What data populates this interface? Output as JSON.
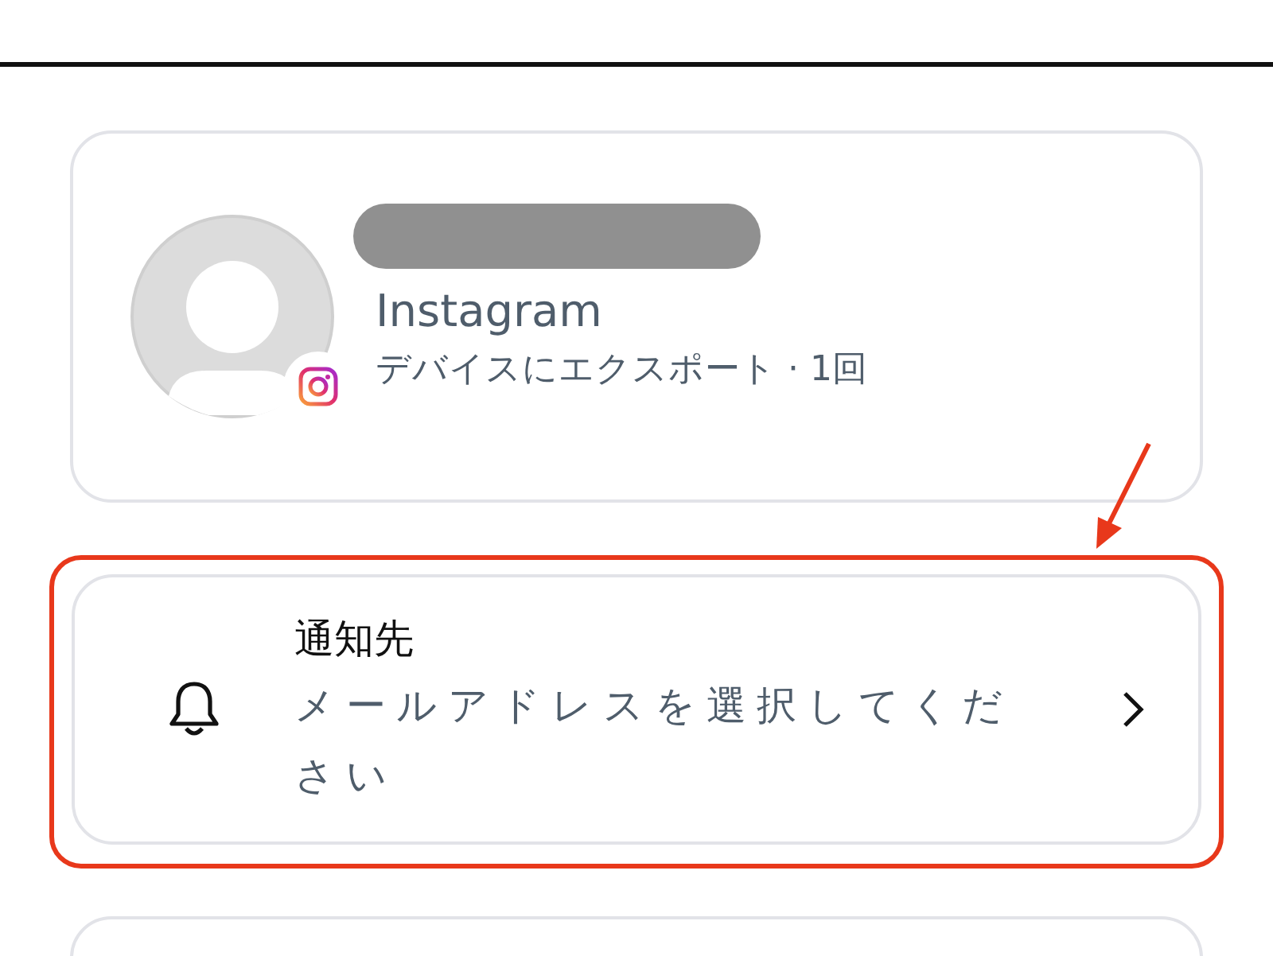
{
  "account": {
    "service": "Instagram",
    "detail": "デバイスにエクスポート · 1回"
  },
  "notification": {
    "title": "通知先",
    "value": "メールアドレスを選択してください",
    "highlighted": true
  }
}
